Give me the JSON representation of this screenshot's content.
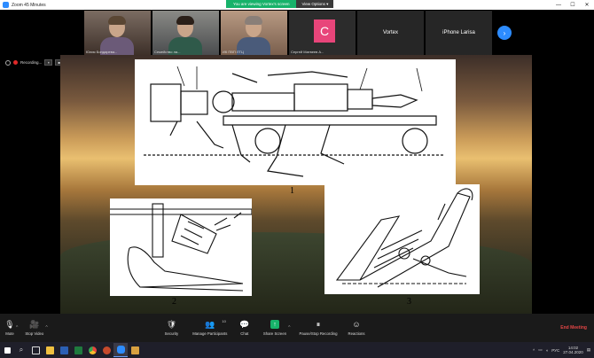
{
  "window": {
    "title": "Zoom 45 Minutes",
    "minimize": "—",
    "maximize": "☐",
    "close": "✕"
  },
  "share_banner": {
    "viewing": "You are viewing Vortex's screen",
    "view_options": "View Options ▾"
  },
  "gallery": {
    "tiles": [
      {
        "name": "Юлия Бондарева..."
      },
      {
        "name": "Семейство ла..."
      },
      {
        "name": "ИК ПВП ЛТЦ"
      },
      {
        "name": "Сергей Матвеев А...",
        "initial": "C",
        "initial_color": "#e8457a"
      },
      {
        "name": "Vortex"
      },
      {
        "name": "iPhone Larisa"
      }
    ],
    "next_icon": "›"
  },
  "recording": {
    "label": "Recording...",
    "pause_icon": "⏸",
    "stop_icon": "■"
  },
  "slide": {
    "labels": [
      "1",
      "2",
      "3"
    ]
  },
  "toolbar": {
    "mute": {
      "label": "Mute",
      "icon": "🎙"
    },
    "video": {
      "label": "Stop Video",
      "icon": "🎥"
    },
    "security": {
      "label": "Security",
      "icon": "🛡"
    },
    "participants": {
      "label": "Manage Participants",
      "count": "10",
      "icon": "👥"
    },
    "chat": {
      "label": "Chat",
      "icon": "💬"
    },
    "share": {
      "label": "Share Screen",
      "icon": "↑"
    },
    "recording": {
      "label": "Pause/Stop Recording",
      "icon": "⏸"
    },
    "reactions": {
      "label": "Reactions",
      "icon": "☺"
    },
    "end": {
      "label": "End Meeting"
    }
  },
  "taskbar": {
    "search_icon": "⌕",
    "apps": [
      "file-explorer",
      "word",
      "excel",
      "chrome",
      "powerpoint",
      "zoom",
      "other"
    ],
    "tray": {
      "language": "РУС",
      "time": "14:02",
      "date": "27.04.2020"
    },
    "accent": "#6aa0ff"
  }
}
